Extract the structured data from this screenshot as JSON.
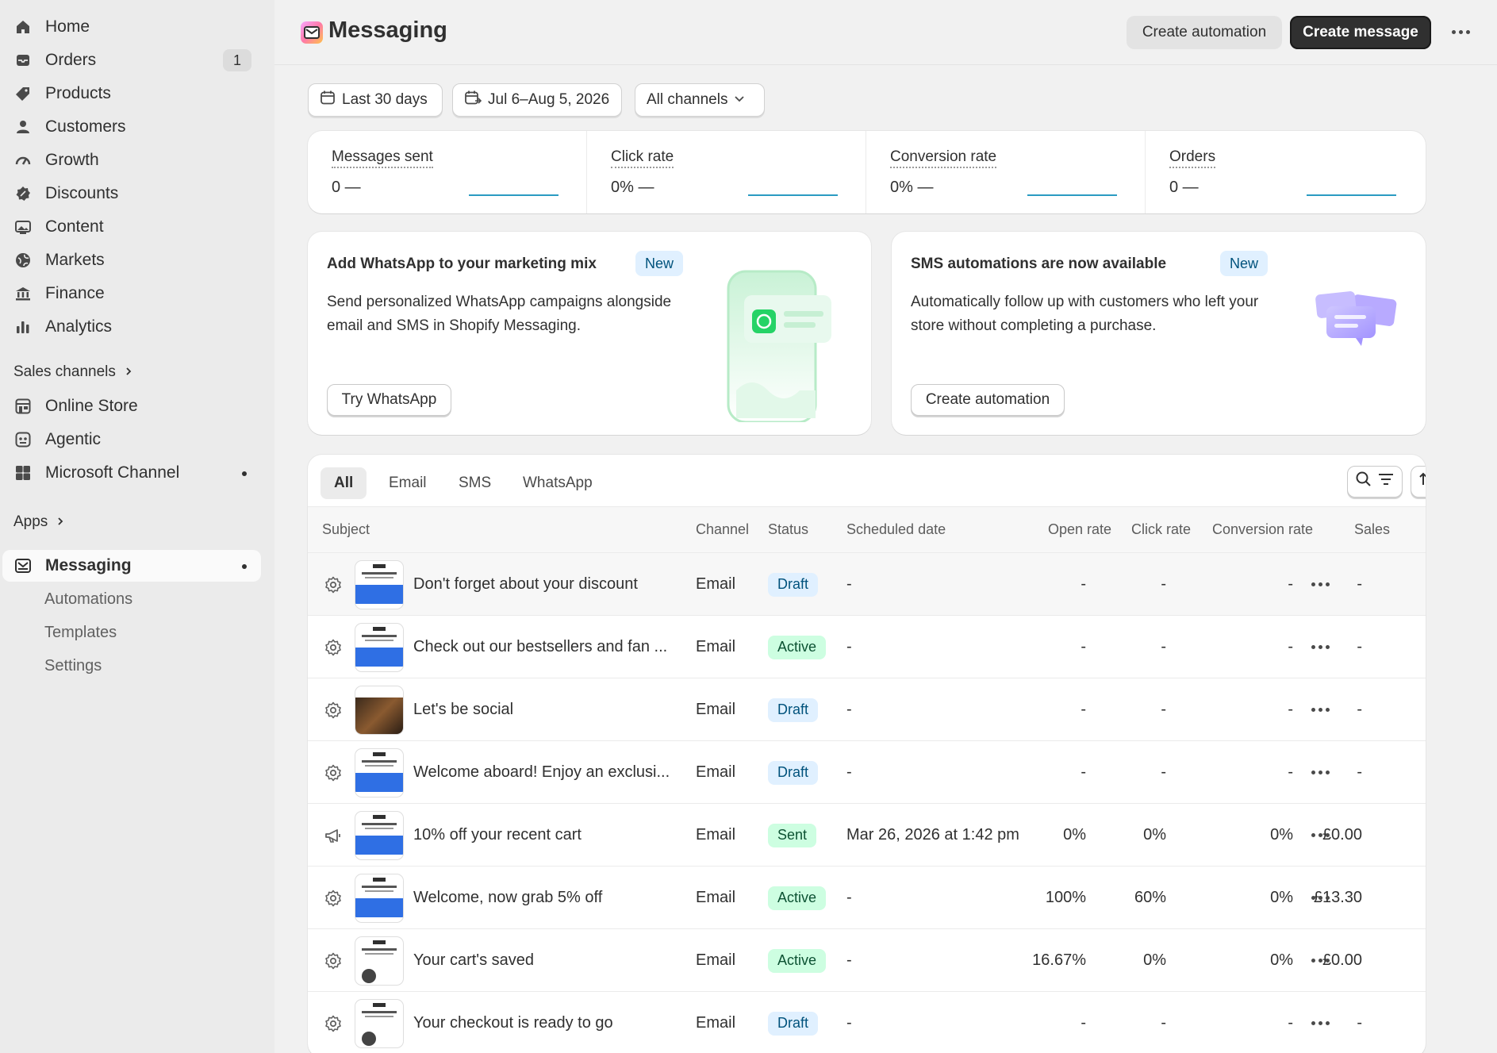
{
  "sidebar": {
    "items": [
      {
        "label": "Home",
        "icon": "home-icon"
      },
      {
        "label": "Orders",
        "icon": "orders-icon",
        "count": "1"
      },
      {
        "label": "Products",
        "icon": "tag-icon"
      },
      {
        "label": "Customers",
        "icon": "person-icon"
      },
      {
        "label": "Growth",
        "icon": "gauge-icon"
      },
      {
        "label": "Discounts",
        "icon": "discount-icon"
      },
      {
        "label": "Content",
        "icon": "image-icon"
      },
      {
        "label": "Markets",
        "icon": "globe-icon"
      },
      {
        "label": "Finance",
        "icon": "bank-icon"
      },
      {
        "label": "Analytics",
        "icon": "bar-chart-icon"
      }
    ],
    "sales_channels_label": "Sales channels",
    "channels": [
      {
        "label": "Online Store",
        "icon": "store-icon"
      },
      {
        "label": "Agentic",
        "icon": "agent-icon"
      },
      {
        "label": "Microsoft Channel",
        "icon": "microsoft-icon"
      }
    ],
    "apps_label": "Apps",
    "active_app": {
      "label": "Messaging",
      "icon": "mail-icon"
    },
    "sub_items": [
      {
        "label": "Automations"
      },
      {
        "label": "Templates"
      },
      {
        "label": "Settings"
      }
    ]
  },
  "header": {
    "title": "Messaging",
    "create_automation": "Create automation",
    "create_message": "Create message"
  },
  "filters": {
    "range": "Last 30 days",
    "dates": "Jul 6–Aug 5, 2026",
    "channels": "All channels"
  },
  "metrics": [
    {
      "title": "Messages sent",
      "value": "0 —"
    },
    {
      "title": "Click rate",
      "value": "0% —"
    },
    {
      "title": "Conversion rate",
      "value": "0% —"
    },
    {
      "title": "Orders",
      "value": "0 —"
    }
  ],
  "promos": [
    {
      "title": "Add WhatsApp to your marketing mix",
      "badge": "New",
      "text": "Send personalized WhatsApp campaigns alongside email and SMS in Shopify Messaging.",
      "button": "Try WhatsApp"
    },
    {
      "title": "SMS automations are now available",
      "badge": "New",
      "text": "Automatically follow up with customers who left your store without completing a purchase.",
      "button": "Create automation"
    }
  ],
  "tabs": [
    "All",
    "Email",
    "SMS",
    "WhatsApp"
  ],
  "columns": [
    "Subject",
    "Channel",
    "Status",
    "Scheduled date",
    "Open rate",
    "Click rate",
    "Conversion rate",
    "Sales"
  ],
  "rows": [
    {
      "icon": "gear-icon",
      "subject": "Don't forget about your discount",
      "channel": "Email",
      "status": "Draft",
      "date": "-",
      "open": "-",
      "click": "-",
      "conv": "-",
      "sales": "-"
    },
    {
      "icon": "gear-icon",
      "subject": "Check out our bestsellers and fan ...",
      "channel": "Email",
      "status": "Active",
      "date": "-",
      "open": "-",
      "click": "-",
      "conv": "-",
      "sales": "-"
    },
    {
      "icon": "gear-icon",
      "subject": "Let's be social",
      "channel": "Email",
      "status": "Draft",
      "date": "-",
      "open": "-",
      "click": "-",
      "conv": "-",
      "sales": "-"
    },
    {
      "icon": "gear-icon",
      "subject": "Welcome aboard! Enjoy an exclusi...",
      "channel": "Email",
      "status": "Draft",
      "date": "-",
      "open": "-",
      "click": "-",
      "conv": "-",
      "sales": "-"
    },
    {
      "icon": "megaphone-icon",
      "subject": "10% off your recent cart",
      "channel": "Email",
      "status": "Sent",
      "date": "Mar 26, 2026 at 1:42 pm",
      "open": "0%",
      "click": "0%",
      "conv": "0%",
      "sales": "£0.00"
    },
    {
      "icon": "gear-icon",
      "subject": "Welcome, now grab 5% off",
      "channel": "Email",
      "status": "Active",
      "date": "-",
      "open": "100%",
      "click": "60%",
      "conv": "0%",
      "sales": "£13.30"
    },
    {
      "icon": "gear-icon",
      "subject": "Your cart's saved",
      "channel": "Email",
      "status": "Active",
      "date": "-",
      "open": "16.67%",
      "click": "0%",
      "conv": "0%",
      "sales": "£0.00"
    },
    {
      "icon": "gear-icon",
      "subject": "Your checkout is ready to go",
      "channel": "Email",
      "status": "Draft",
      "date": "-",
      "open": "-",
      "click": "-",
      "conv": "-",
      "sales": "-"
    }
  ]
}
